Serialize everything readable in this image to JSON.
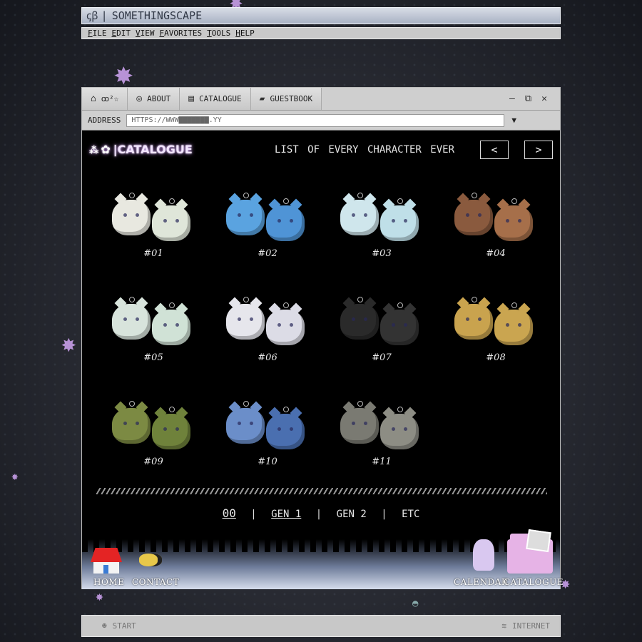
{
  "app": {
    "title": "SOMETHINGSCAPE",
    "logo_glyph": "ꞔꞵ"
  },
  "menu": {
    "items": [
      "FILE",
      "EDIT",
      "VIEW",
      "FAVORITES",
      "TOOLS",
      "HELP"
    ]
  },
  "tabs": [
    {
      "label": "",
      "icon": "home-icon",
      "extra": "ꝏ²☆"
    },
    {
      "label": "ABOUT",
      "icon": "globe-icon"
    },
    {
      "label": "CATALOGUE",
      "icon": "document-icon"
    },
    {
      "label": "GUESTBOOK",
      "icon": "chat-icon"
    }
  ],
  "window_controls": {
    "minimize": "—",
    "restore": "⧉",
    "close": "✕"
  },
  "address": {
    "label": "ADDRESS",
    "value": "HTTPS://WWW▇▇▇▇▇▇▇.YY",
    "dropdown": "▼"
  },
  "page": {
    "title": "CATALOGUE",
    "subtitle": "LIST OF EVERY CHARACTER EVER",
    "prev": "<",
    "next": ">"
  },
  "characters": [
    {
      "id": "#01",
      "color": "#e8e8e0",
      "color2": "#dfe6d9"
    },
    {
      "id": "#02",
      "color": "#5aa3e0",
      "color2": "#4f94d6"
    },
    {
      "id": "#03",
      "color": "#cfe6ec",
      "color2": "#bfdfe8"
    },
    {
      "id": "#04",
      "color": "#8a5a3e",
      "color2": "#a66f4a"
    },
    {
      "id": "#05",
      "color": "#d8e4dc",
      "color2": "#d0e2d6"
    },
    {
      "id": "#06",
      "color": "#e6e6ec",
      "color2": "#dcdce6"
    },
    {
      "id": "#07",
      "color": "#2a2a2a",
      "color2": "#333333"
    },
    {
      "id": "#08",
      "color": "#c9a34e",
      "color2": "#caa550"
    },
    {
      "id": "#09",
      "color": "#7c8a43",
      "color2": "#6f823b"
    },
    {
      "id": "#10",
      "color": "#6b8ec9",
      "color2": "#4a6fb0"
    },
    {
      "id": "#11",
      "color": "#7a7a72",
      "color2": "#8d8d84"
    }
  ],
  "generations": [
    "00",
    "GEN 1",
    "GEN 2",
    "ETC"
  ],
  "bottom_nav": {
    "home": "HOME",
    "contact": "CONTACT",
    "calendar": "CALENDAR",
    "catalogue": "CATALOGUE"
  },
  "taskbar": {
    "start": "START",
    "internet": "INTERNET"
  }
}
